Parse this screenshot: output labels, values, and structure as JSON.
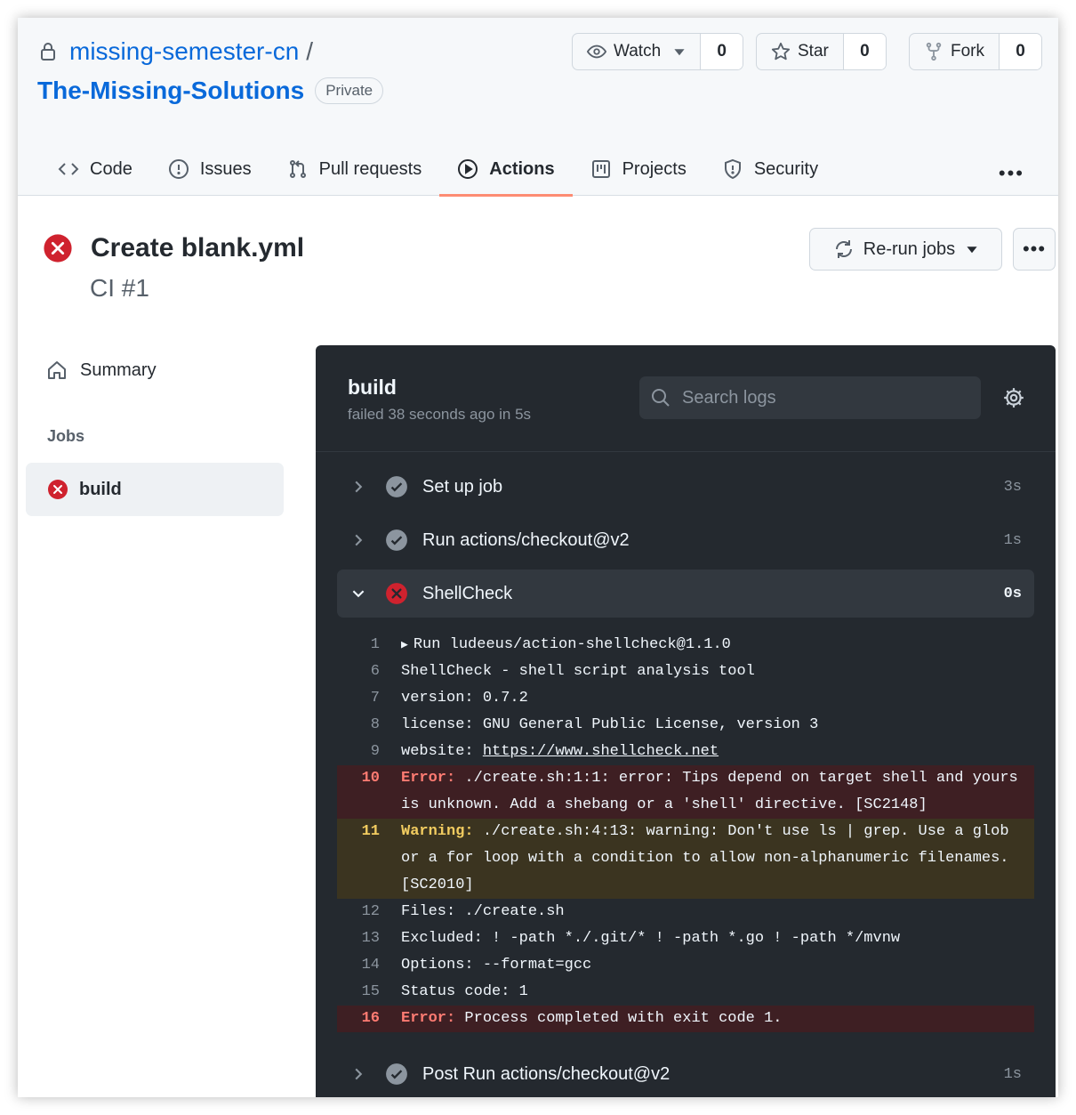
{
  "repo": {
    "owner": "missing-semester-cn",
    "separator": "/",
    "name": "The-Missing-Solutions",
    "visibility": "Private"
  },
  "repo_actions": {
    "watch_label": "Watch",
    "watch_count": "0",
    "star_label": "Star",
    "star_count": "0",
    "fork_label": "Fork",
    "fork_count": "0"
  },
  "tabs": [
    {
      "label": "Code",
      "icon": "code-icon"
    },
    {
      "label": "Issues",
      "icon": "issue-icon"
    },
    {
      "label": "Pull requests",
      "icon": "pull-request-icon"
    },
    {
      "label": "Actions",
      "icon": "play-icon",
      "active": true
    },
    {
      "label": "Projects",
      "icon": "project-icon"
    },
    {
      "label": "Security",
      "icon": "shield-icon"
    }
  ],
  "run": {
    "title": "Create blank.yml",
    "subtitle": "CI #1",
    "status": "failure",
    "rerun_label": "Re-run jobs"
  },
  "sidebar": {
    "summary_label": "Summary",
    "jobs_heading": "Jobs",
    "job_name": "build"
  },
  "log": {
    "job_name": "build",
    "status_text": "failed 38 seconds ago in 5s",
    "search_placeholder": "Search logs",
    "steps": [
      {
        "name": "Set up job",
        "time": "3s",
        "status": "success"
      },
      {
        "name": "Run actions/checkout@v2",
        "time": "1s",
        "status": "success"
      },
      {
        "name": "ShellCheck",
        "time": "0s",
        "status": "failure"
      },
      {
        "name": "Post Run actions/checkout@v2",
        "time": "1s",
        "status": "success"
      }
    ],
    "lines": [
      {
        "num": "1",
        "text": "Run ludeeus/action-shellcheck@1.1.0"
      },
      {
        "num": "6",
        "text": "ShellCheck - shell script analysis tool"
      },
      {
        "num": "7",
        "text": "version: 0.7.2"
      },
      {
        "num": "8",
        "text": "license: GNU General Public License, version 3"
      },
      {
        "num": "9",
        "prefix": "website: ",
        "link": "https://www.shellcheck.net"
      },
      {
        "num": "10",
        "tag": "Error:",
        "text": " ./create.sh:1:1: error: Tips depend on target shell and yours is unknown. Add a shebang or a 'shell' directive. [SC2148]"
      },
      {
        "num": "11",
        "tag": "Warning:",
        "text": " ./create.sh:4:13: warning: Don't use ls | grep. Use a glob or a for loop with a condition to allow non-alphanumeric filenames. [SC2010]"
      },
      {
        "num": "12",
        "text": "Files: ./create.sh"
      },
      {
        "num": "13",
        "text": "Excluded: ! -path *./.git/* ! -path *.go ! -path */mvnw"
      },
      {
        "num": "14",
        "text": "Options: --format=gcc"
      },
      {
        "num": "15",
        "text": "Status code: 1"
      },
      {
        "num": "16",
        "tag": "Error:",
        "text": " Process completed with exit code 1."
      }
    ]
  },
  "colors": {
    "link": "#0969da",
    "active_tab_underline": "#fd8c73",
    "failure": "#cf222e",
    "log_bg": "#24292f",
    "error_row": "#3e1f23",
    "warning_row": "#3b3420"
  }
}
